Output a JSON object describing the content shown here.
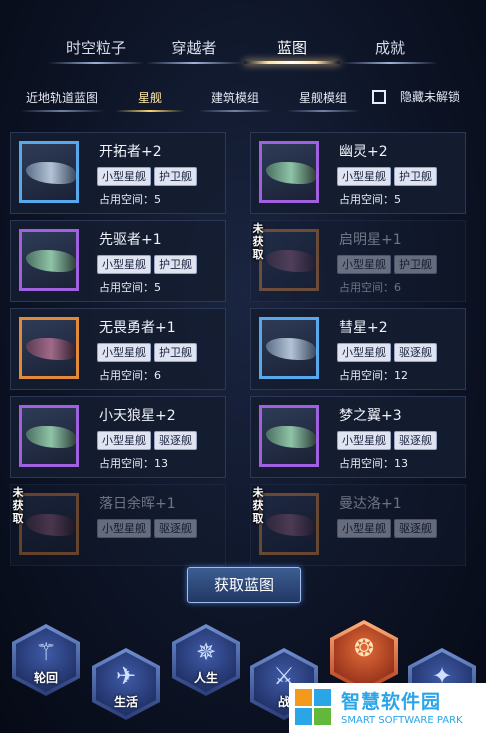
{
  "top_tabs": [
    {
      "label": "时空粒子"
    },
    {
      "label": "穿越者"
    },
    {
      "label": "蓝图"
    },
    {
      "label": "成就"
    }
  ],
  "sub_tabs": [
    {
      "label": "近地轨道蓝图"
    },
    {
      "label": "星舰"
    },
    {
      "label": "建筑模组"
    },
    {
      "label": "星舰模组"
    }
  ],
  "hide_locked_label": "隐藏未解锁",
  "ships": [
    {
      "name": "开拓者+2",
      "tags": [
        "小型星舰",
        "护卫舰"
      ],
      "space": "占用空间：5",
      "rarity_color": "#58a8ec",
      "locked": false
    },
    {
      "name": "幽灵+2",
      "tags": [
        "小型星舰",
        "护卫舰"
      ],
      "space": "占用空间：5",
      "rarity_color": "#a060e0",
      "locked": false
    },
    {
      "name": "先驱者+1",
      "tags": [
        "小型星舰",
        "护卫舰"
      ],
      "space": "占用空间：5",
      "rarity_color": "#a060e0",
      "locked": false
    },
    {
      "name": "启明星+1",
      "tags": [
        "小型星舰",
        "护卫舰"
      ],
      "space": "占用空间：6",
      "rarity_color": "#e08a3a",
      "locked": true
    },
    {
      "name": "无畏勇者+1",
      "tags": [
        "小型星舰",
        "护卫舰"
      ],
      "space": "占用空间：6",
      "rarity_color": "#e08a3a",
      "locked": false
    },
    {
      "name": "彗星+2",
      "tags": [
        "小型星舰",
        "驱逐舰"
      ],
      "space": "占用空间：12",
      "rarity_color": "#58a8ec",
      "locked": false
    },
    {
      "name": "小天狼星+2",
      "tags": [
        "小型星舰",
        "驱逐舰"
      ],
      "space": "占用空间：13",
      "rarity_color": "#a060e0",
      "locked": false
    },
    {
      "name": "梦之翼+3",
      "tags": [
        "小型星舰",
        "驱逐舰"
      ],
      "space": "占用空间：13",
      "rarity_color": "#a060e0",
      "locked": false
    },
    {
      "name": "落日余晖+1",
      "tags": [
        "小型星舰",
        "驱逐舰"
      ],
      "space": "",
      "rarity_color": "#e08a3a",
      "locked": true
    },
    {
      "name": "曼达洛+1",
      "tags": [
        "小型星舰",
        "驱逐舰"
      ],
      "space": "",
      "rarity_color": "#e08a3a",
      "locked": true
    }
  ],
  "locked_badge": "未获取",
  "get_button_label": "获取蓝图",
  "bottom_nav": [
    {
      "label": "轮回",
      "icon": "dna-helix-icon"
    },
    {
      "label": "生活",
      "icon": "book-wing-icon"
    },
    {
      "label": "人生",
      "icon": "wings-crest-icon"
    },
    {
      "label": "战",
      "icon": "battle-icon"
    },
    {
      "label": "",
      "icon": "blueprint-emblem-icon"
    },
    {
      "label": "",
      "icon": "extra-icon"
    }
  ],
  "watermark": {
    "brand": "智慧软件园",
    "brand_en": "SMART SOFTWARE PARK"
  }
}
